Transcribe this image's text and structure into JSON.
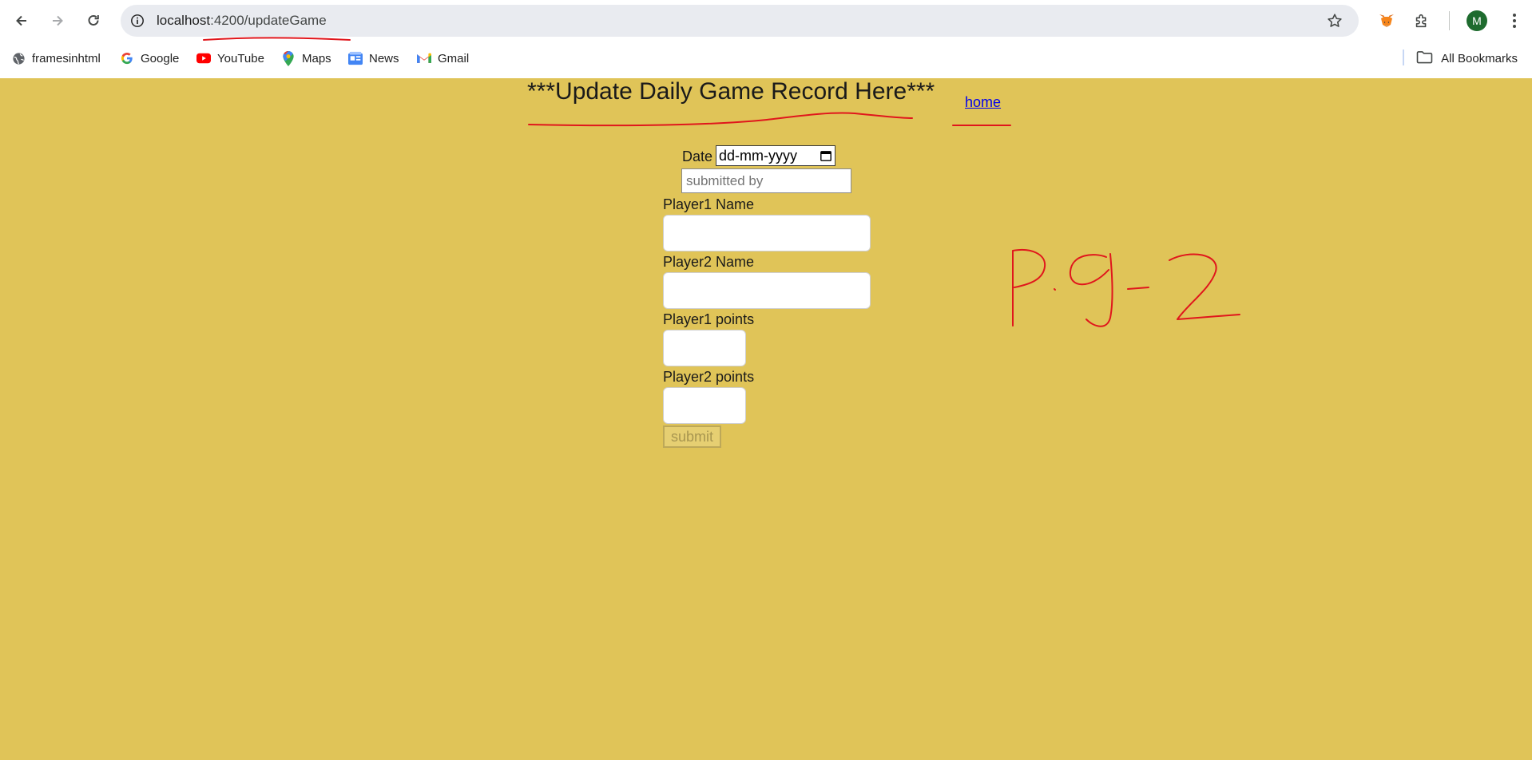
{
  "browser": {
    "url_host": "localhost",
    "url_path": ":4200/updateGame",
    "profile_initial": "M",
    "icons": {
      "back": "back-arrow-icon",
      "forward": "forward-arrow-icon",
      "reload": "reload-icon",
      "site_info": "site-info-icon",
      "star": "star-icon",
      "extension_1": "metamask-fox-icon",
      "extension_2": "puzzle-extensions-icon",
      "menu": "kebab-menu-icon"
    }
  },
  "bookmarks": {
    "items": [
      {
        "label": "framesinhtml",
        "icon": "globe-icon"
      },
      {
        "label": "Google",
        "icon": "google-icon"
      },
      {
        "label": "YouTube",
        "icon": "youtube-icon"
      },
      {
        "label": "Maps",
        "icon": "maps-pin-icon"
      },
      {
        "label": "News",
        "icon": "news-icon"
      },
      {
        "label": "Gmail",
        "icon": "gmail-icon"
      }
    ],
    "all_bookmarks": "All Bookmarks"
  },
  "page": {
    "title": "***Update Daily Game Record Here***",
    "home_link": "home",
    "form": {
      "date_label": "Date",
      "date_value": "dd-mm-yyyy",
      "submitted_by_placeholder": "submitted by",
      "player1_name_label": "Player1 Name",
      "player2_name_label": "Player2 Name",
      "player1_points_label": "Player1 points",
      "player2_points_label": "Player2 points",
      "submit_label": "submit"
    }
  },
  "annotation": {
    "handwritten_text": "P.g-2",
    "ink_color": "#e0161c"
  },
  "colors": {
    "page_background": "#e0c458",
    "link": "#0000ee"
  }
}
